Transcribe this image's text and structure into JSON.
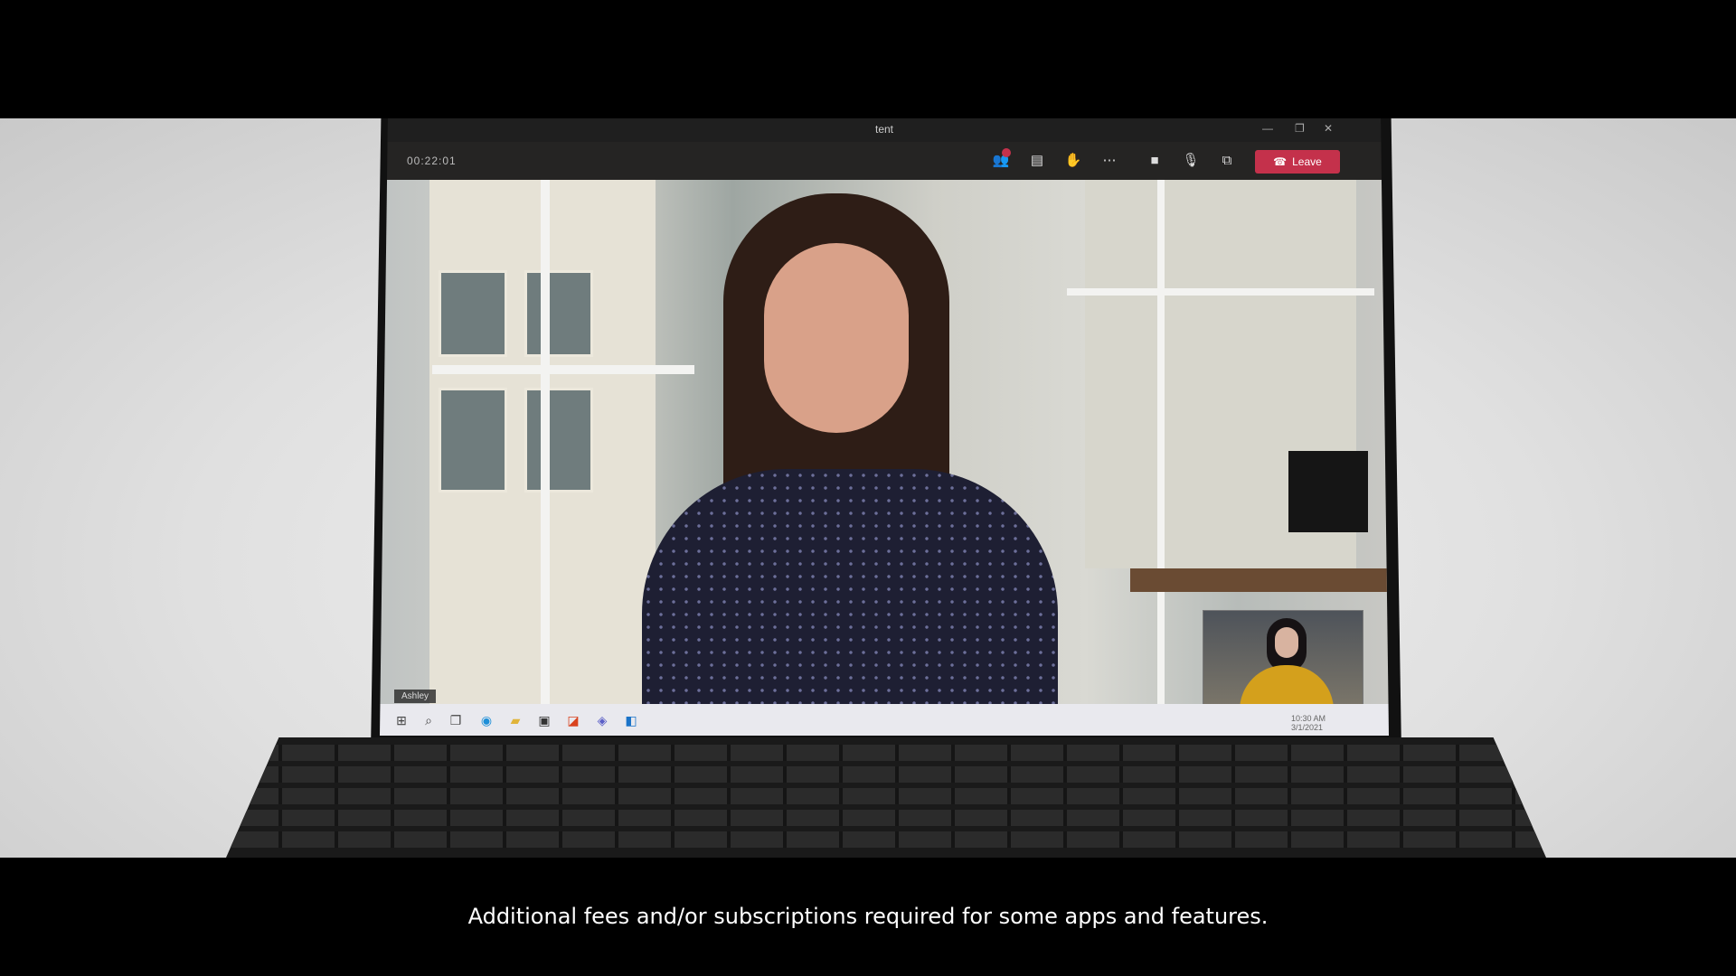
{
  "window": {
    "title": "tent",
    "meeting_timer": "00:22:01",
    "controls": {
      "minimize": "—",
      "maximize": "❐",
      "close": "✕"
    }
  },
  "toolbar": {
    "icons": [
      "participants-icon",
      "chat-icon",
      "raise-hand-icon",
      "more-icon",
      "camera-icon",
      "mic-icon",
      "share-icon"
    ],
    "leave_label": "Leave"
  },
  "video": {
    "participant_name": "Ashley"
  },
  "taskbar": {
    "apps": [
      "start-icon",
      "search-icon",
      "task-view-icon",
      "edge-icon",
      "file-explorer-icon",
      "store-icon",
      "office-icon",
      "teams-icon",
      "outlook-icon"
    ],
    "tray_time": "10:30 AM",
    "tray_date": "3/1/2021"
  },
  "caption": {
    "text": "Additional fees and/or subscriptions required for some apps and features."
  }
}
